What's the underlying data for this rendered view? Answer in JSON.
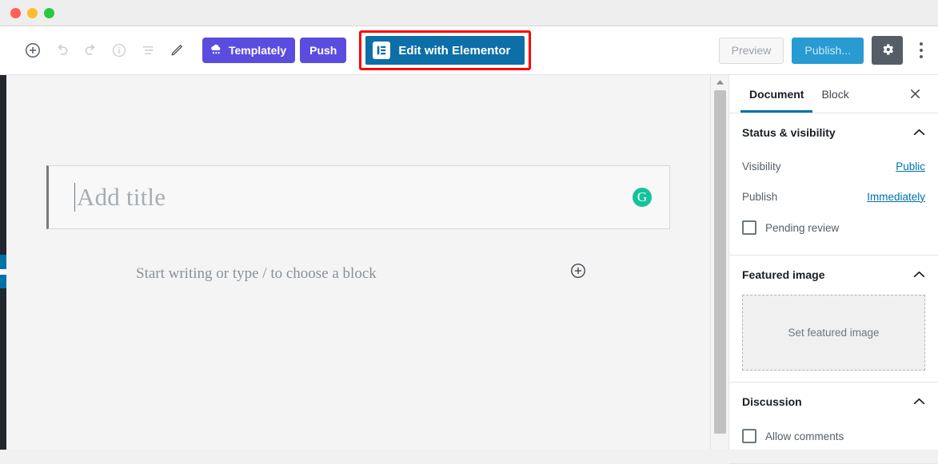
{
  "window": {
    "traffic_lights": [
      {
        "name": "close",
        "color": "#ff5f57"
      },
      {
        "name": "minimize",
        "color": "#febc2e"
      },
      {
        "name": "zoom",
        "color": "#28c840"
      }
    ]
  },
  "toolbar": {
    "icons": [
      {
        "name": "add-block-icon",
        "label": "Add block"
      },
      {
        "name": "undo-icon",
        "label": "Undo"
      },
      {
        "name": "redo-icon",
        "label": "Redo"
      },
      {
        "name": "info-icon",
        "label": "Content structure"
      },
      {
        "name": "list-view-icon",
        "label": "Block navigation"
      },
      {
        "name": "pencil-icon",
        "label": "Edit"
      }
    ],
    "templately_label": "Templately",
    "push_label": "Push",
    "elementor_label": "Edit with Elementor",
    "preview_label": "Preview",
    "publish_label": "Publish...",
    "settings_label": "Settings",
    "more_label": "More tools & options"
  },
  "editor": {
    "title_placeholder": "Add title",
    "title_value": "",
    "block_placeholder": "Start writing or type / to choose a block",
    "grammarly_glyph": "G",
    "inserter_label": "Add block"
  },
  "sidebar": {
    "tabs": [
      {
        "label": "Document",
        "active": true
      },
      {
        "label": "Block",
        "active": false
      }
    ],
    "close_label": "Close settings",
    "panels": [
      {
        "title": "Status & visibility",
        "rows": [
          {
            "label": "Visibility",
            "value": "Public"
          },
          {
            "label": "Publish",
            "value": "Immediately"
          }
        ],
        "checkbox": {
          "label": "Pending review",
          "checked": false
        }
      },
      {
        "title": "Featured image",
        "dropzone_label": "Set featured image"
      },
      {
        "title": "Discussion",
        "checkbox": {
          "label": "Allow comments",
          "checked": false
        }
      }
    ]
  },
  "colors": {
    "elementor_blue": "#0d6fa8",
    "templately_purple": "#5b4ce0",
    "publish_blue": "#289bd2",
    "highlight_red": "#ff0000",
    "link_blue": "#0073aa",
    "grammarly_green": "#15c39a",
    "admin_rail_dark": "#23282d"
  }
}
